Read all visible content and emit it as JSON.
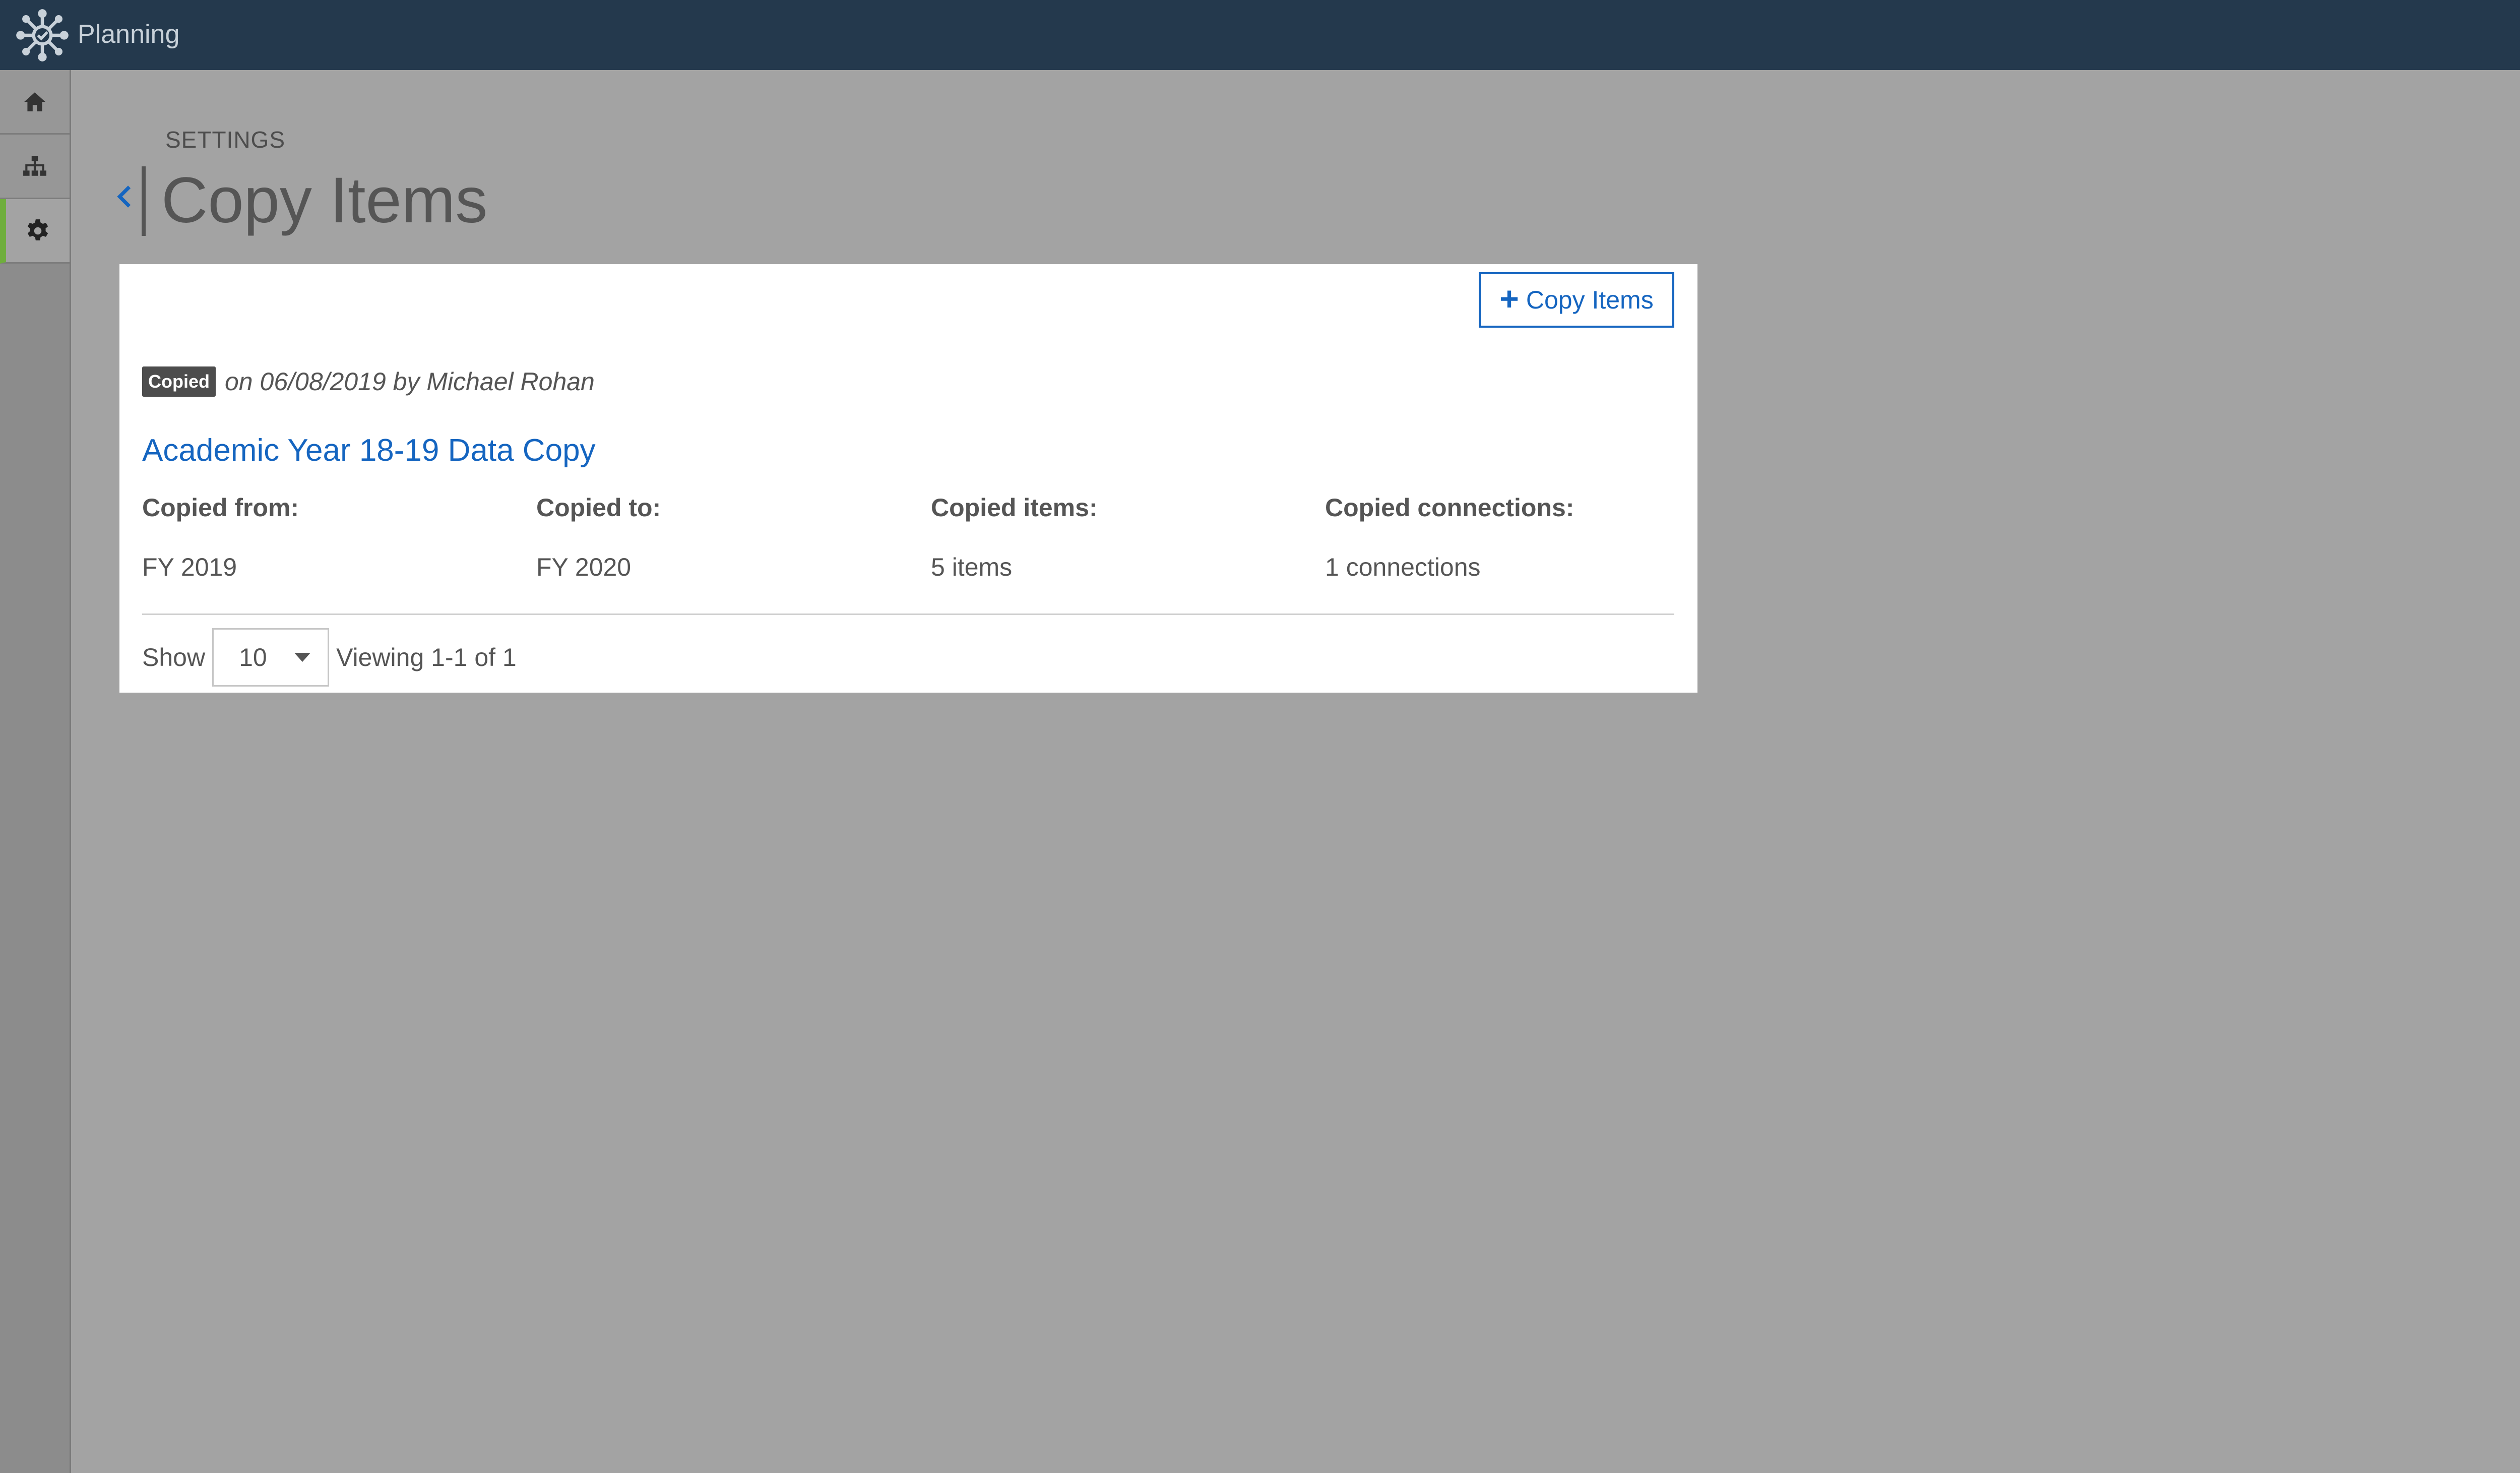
{
  "app": {
    "name": "Planning"
  },
  "nav": [
    {
      "icon": "home-icon",
      "active": false
    },
    {
      "icon": "sitemap-icon",
      "active": false
    },
    {
      "icon": "gear-icon",
      "active": true
    }
  ],
  "header": {
    "eyebrow": "SETTINGS",
    "title": "Copy Items"
  },
  "panel": {
    "action_button": "Copy Items",
    "badge": "Copied",
    "meta": "on 06/08/2019 by Michael Rohan",
    "record_title": "Academic Year 18-19 Data Copy",
    "columns": [
      {
        "label": "Copied from:",
        "value": "FY 2019"
      },
      {
        "label": "Copied to:",
        "value": "FY 2020"
      },
      {
        "label": "Copied items:",
        "value": "5 items"
      },
      {
        "label": "Copied connections:",
        "value": "1 connections"
      }
    ],
    "footer": {
      "show_label": "Show",
      "page_size": "10",
      "viewing": "Viewing 1-1 of 1"
    }
  },
  "colors": {
    "topbar": "#24394d",
    "accent": "#1565c0",
    "active_nav": "#6fae3d"
  }
}
